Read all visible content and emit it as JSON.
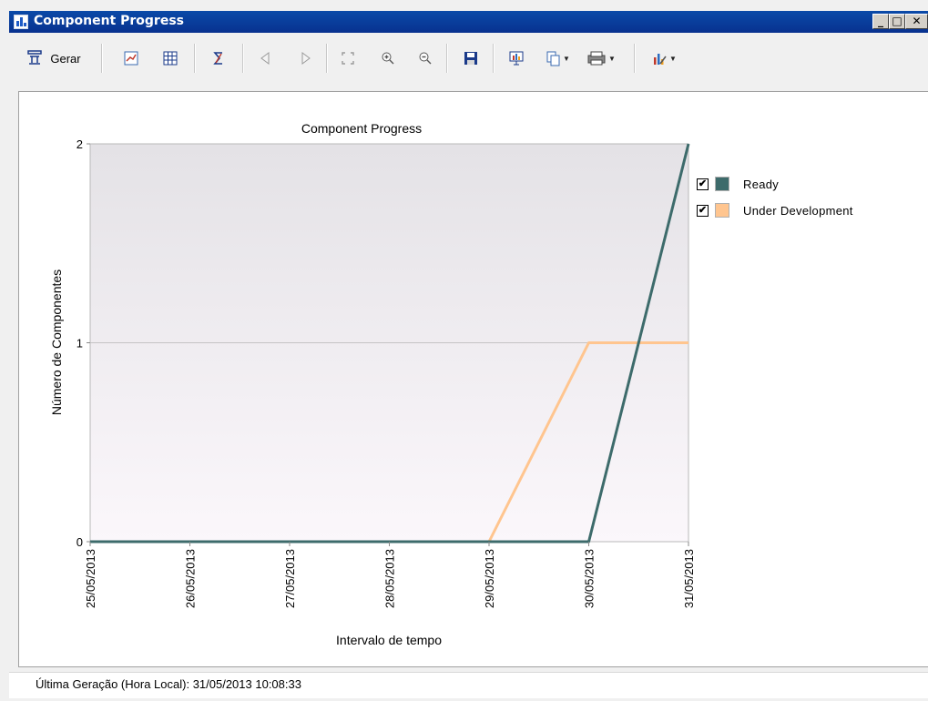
{
  "window": {
    "title": "Component Progress"
  },
  "toolbar": {
    "generate_label": "Gerar"
  },
  "status": {
    "label": "Última Geração (Hora Local):",
    "value": "31/05/2013 10:08:33"
  },
  "chart_data": {
    "type": "line",
    "title": "Component Progress",
    "xlabel": "Intervalo de tempo",
    "ylabel": "Número de Componentes",
    "categories": [
      "25/05/2013",
      "26/05/2013",
      "27/05/2013",
      "28/05/2013",
      "29/05/2013",
      "30/05/2013",
      "31/05/2013"
    ],
    "ylim": [
      0,
      2
    ],
    "yticks": [
      0,
      1,
      2
    ],
    "grid": true,
    "legend_position": "right",
    "series": [
      {
        "name": "Ready",
        "color": "#3d6b6b",
        "values": [
          0,
          0,
          0,
          0,
          0,
          0,
          2
        ],
        "visible": true
      },
      {
        "name": "Under Development",
        "color": "#ffc58f",
        "values": [
          0,
          0,
          0,
          0,
          0,
          1,
          1
        ],
        "visible": true
      }
    ]
  }
}
